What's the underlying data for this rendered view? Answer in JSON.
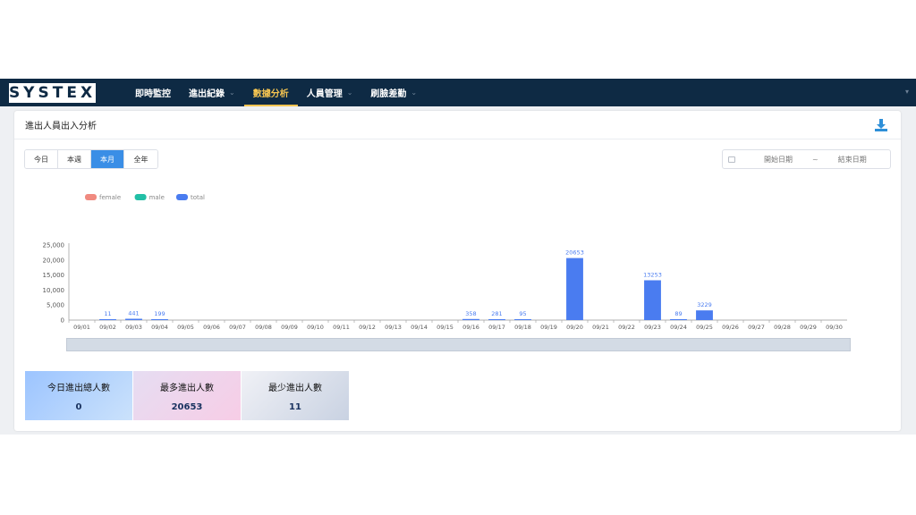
{
  "navbar": {
    "logo_text": "SYSTEX",
    "items": [
      {
        "label": "即時監控",
        "has_dropdown": false,
        "active": false
      },
      {
        "label": "進出紀錄",
        "has_dropdown": true,
        "active": false
      },
      {
        "label": "數據分析",
        "has_dropdown": false,
        "active": true
      },
      {
        "label": "人員管理",
        "has_dropdown": true,
        "active": false
      },
      {
        "label": "刷臉差勤",
        "has_dropdown": true,
        "active": false
      }
    ],
    "active_color": "#f5c451",
    "background": "#0e2a44"
  },
  "card": {
    "title": "進出人員出入分析",
    "download_icon": "download-icon"
  },
  "period_tabs": [
    {
      "label": "今日",
      "selected": false
    },
    {
      "label": "本週",
      "selected": false
    },
    {
      "label": "本月",
      "selected": true
    },
    {
      "label": "全年",
      "selected": false
    }
  ],
  "date_range": {
    "start_placeholder": "開始日期",
    "separator": "~",
    "end_placeholder": "結束日期",
    "icon": "calendar-icon"
  },
  "chart_data": {
    "type": "bar",
    "legend": [
      {
        "name": "female",
        "color": "#f08a80"
      },
      {
        "name": "male",
        "color": "#22bfa6"
      },
      {
        "name": "total",
        "color": "#4a7cf0"
      }
    ],
    "categories": [
      "09/01",
      "09/02",
      "09/03",
      "09/04",
      "09/05",
      "09/06",
      "09/07",
      "09/08",
      "09/09",
      "09/10",
      "09/11",
      "09/12",
      "09/13",
      "09/14",
      "09/15",
      "09/16",
      "09/17",
      "09/18",
      "09/19",
      "09/20",
      "09/21",
      "09/22",
      "09/23",
      "09/24",
      "09/25",
      "09/26",
      "09/27",
      "09/28",
      "09/29",
      "09/30"
    ],
    "series": [
      {
        "name": "total",
        "color": "#4a7cf0",
        "values": [
          null,
          11,
          441,
          199,
          null,
          null,
          null,
          null,
          null,
          null,
          null,
          null,
          null,
          null,
          null,
          358,
          281,
          95,
          null,
          20653,
          null,
          null,
          13253,
          89,
          3229,
          null,
          null,
          null,
          null,
          null
        ]
      }
    ],
    "yticks": [
      "0",
      "5,000",
      "10,000",
      "15,000",
      "20,000",
      "25,000"
    ],
    "ylim": [
      0,
      25000
    ],
    "grid": false,
    "legend_position": "top-left"
  },
  "stats": [
    {
      "label": "今日進出總人數",
      "value": "0"
    },
    {
      "label": "最多進出人數",
      "value": "20653"
    },
    {
      "label": "最少進出人數",
      "value": "11"
    }
  ]
}
